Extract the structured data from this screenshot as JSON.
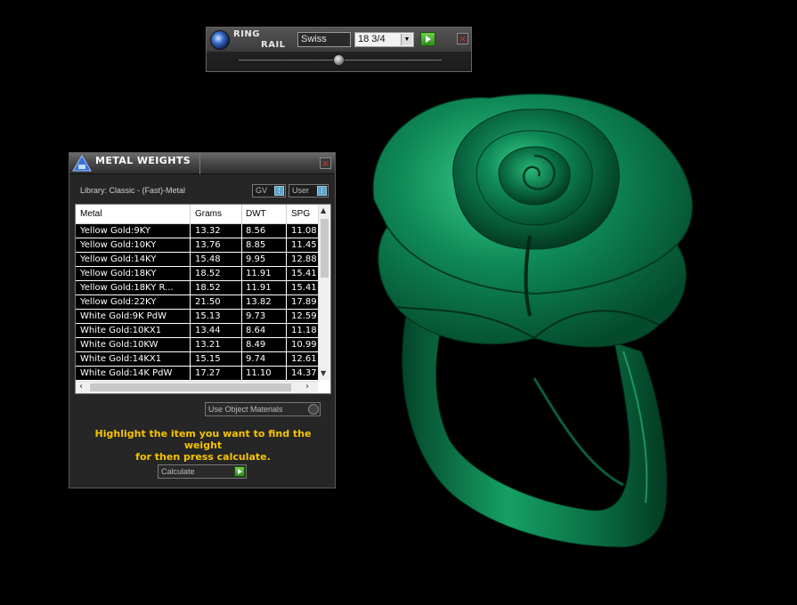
{
  "ring_rail": {
    "title_line1": "RING",
    "title_line2": "RAIL",
    "size_system": "Swiss",
    "size_value": "18 3/4",
    "logo_icon": "ring-rail-logo-icon",
    "go_icon": "play-icon",
    "close_icon": "close-icon"
  },
  "metal_weights": {
    "title": "METAL WEIGHTS",
    "library": "Library: Classic - (Fast)-Metal",
    "gv_label": "GV",
    "user_label": "User",
    "columns": [
      "Metal",
      "Grams",
      "DWT",
      "SPG"
    ],
    "rows": [
      {
        "metal": "Yellow Gold:9KY",
        "grams": "13.32",
        "dwt": "8.56",
        "spg": "11.08"
      },
      {
        "metal": "Yellow Gold:10KY",
        "grams": "13.76",
        "dwt": "8.85",
        "spg": "11.45"
      },
      {
        "metal": "Yellow Gold:14KY",
        "grams": "15.48",
        "dwt": "9.95",
        "spg": "12.88"
      },
      {
        "metal": "Yellow Gold:18KY",
        "grams": "18.52",
        "dwt": "11.91",
        "spg": "15.41"
      },
      {
        "metal": "Yellow Gold:18KY R...",
        "grams": "18.52",
        "dwt": "11.91",
        "spg": "15.41"
      },
      {
        "metal": "Yellow Gold:22KY",
        "grams": "21.50",
        "dwt": "13.82",
        "spg": "17.89"
      },
      {
        "metal": "White Gold:9K PdW",
        "grams": "15.13",
        "dwt": "9.73",
        "spg": "12.59"
      },
      {
        "metal": "White Gold:10KX1",
        "grams": "13.44",
        "dwt": "8.64",
        "spg": "11.18"
      },
      {
        "metal": "White Gold:10KW",
        "grams": "13.21",
        "dwt": "8.49",
        "spg": "10.99"
      },
      {
        "metal": "White Gold:14KX1",
        "grams": "15.15",
        "dwt": "9.74",
        "spg": "12.61"
      },
      {
        "metal": "White Gold:14K PdW",
        "grams": "17.27",
        "dwt": "11.10",
        "spg": "14.37"
      }
    ],
    "use_object_materials": "Use Object Materials",
    "hint_line1": "Highlight the item you want to find the weight",
    "hint_line2": "for then press calculate.",
    "calculate_label": "Calculate",
    "hint_color": "#f6c400"
  },
  "viewport": {
    "object": "rose-ring-model",
    "model_color": "#0a7a4f"
  }
}
